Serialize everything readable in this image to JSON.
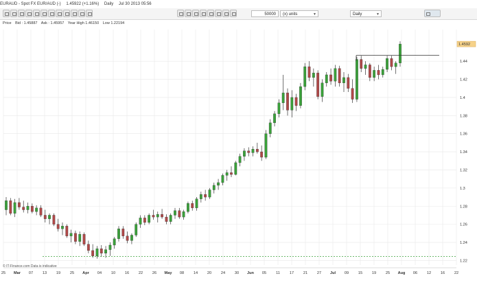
{
  "title_bar": {
    "symbol": "EURAUD - Spot FX EUR/AUD (-)",
    "price": "1.45922 (+1.16%)",
    "interval": "Daily",
    "datetime": "Jul 30 2013 05:56"
  },
  "toolbar": {
    "quantity": "50000",
    "units_label": "(x) units",
    "period": "Daily"
  },
  "infobar": {
    "price_label": "Price",
    "bid": "Bid : 1.45887",
    "ask": "Ask : 1.45957",
    "year_high": "Year High 1.46150",
    "low": "Low 1.22194"
  },
  "footer": "© IT-Finance.com  Data is indicative",
  "colors": {
    "up": "#3aa13a",
    "down": "#b04848",
    "wick": "#333333",
    "grid": "#e8e8e8",
    "support": "#3aa13a",
    "price_tag": "#f6d28a"
  },
  "chart_data": {
    "type": "candlestick",
    "y_ticks": [
      "1.44",
      "1.42",
      "1.4",
      "1.38",
      "1.36",
      "1.34",
      "1.32",
      "1.3",
      "1.28",
      "1.26",
      "1.24",
      "1.22"
    ],
    "x_ticks": [
      "25",
      "Mar",
      "07",
      "13",
      "19",
      "25",
      "Apr",
      "04",
      "10",
      "16",
      "22",
      "26",
      "May",
      "08",
      "14",
      "20",
      "24",
      "30",
      "Jun",
      "05",
      "11",
      "17",
      "21",
      "27",
      "Jul",
      "09",
      "15",
      "19",
      "25",
      "Aug",
      "06",
      "12",
      "16",
      "22"
    ],
    "last_price_tag": "1.4592",
    "ylim": [
      1.215,
      1.475
    ],
    "resistance_level": 1.4465,
    "support_level": 1.2245,
    "grid": true,
    "candles": [
      [
        1.276,
        1.29,
        1.27,
        1.286
      ],
      [
        1.286,
        1.289,
        1.27,
        1.272
      ],
      [
        1.272,
        1.288,
        1.268,
        1.284
      ],
      [
        1.284,
        1.289,
        1.276,
        1.279
      ],
      [
        1.279,
        1.286,
        1.273,
        1.276
      ],
      [
        1.276,
        1.284,
        1.272,
        1.28
      ],
      [
        1.28,
        1.283,
        1.272,
        1.274
      ],
      [
        1.274,
        1.281,
        1.27,
        1.278
      ],
      [
        1.278,
        1.281,
        1.268,
        1.27
      ],
      [
        1.27,
        1.276,
        1.262,
        1.266
      ],
      [
        1.266,
        1.272,
        1.26,
        1.27
      ],
      [
        1.27,
        1.272,
        1.258,
        1.26
      ],
      [
        1.26,
        1.266,
        1.252,
        1.255
      ],
      [
        1.255,
        1.262,
        1.248,
        1.258
      ],
      [
        1.258,
        1.26,
        1.245,
        1.247
      ],
      [
        1.247,
        1.254,
        1.24,
        1.25
      ],
      [
        1.25,
        1.253,
        1.238,
        1.241
      ],
      [
        1.241,
        1.252,
        1.236,
        1.249
      ],
      [
        1.249,
        1.251,
        1.236,
        1.238
      ],
      [
        1.238,
        1.242,
        1.228,
        1.231
      ],
      [
        1.231,
        1.238,
        1.223,
        1.225
      ],
      [
        1.225,
        1.236,
        1.222,
        1.233
      ],
      [
        1.233,
        1.237,
        1.224,
        1.228
      ],
      [
        1.228,
        1.236,
        1.223,
        1.232
      ],
      [
        1.232,
        1.24,
        1.225,
        1.237
      ],
      [
        1.237,
        1.246,
        1.233,
        1.244
      ],
      [
        1.244,
        1.258,
        1.241,
        1.255
      ],
      [
        1.255,
        1.258,
        1.244,
        1.247
      ],
      [
        1.247,
        1.252,
        1.239,
        1.242
      ],
      [
        1.242,
        1.25,
        1.238,
        1.248
      ],
      [
        1.248,
        1.262,
        1.246,
        1.26
      ],
      [
        1.26,
        1.27,
        1.256,
        1.267
      ],
      [
        1.267,
        1.27,
        1.259,
        1.262
      ],
      [
        1.262,
        1.272,
        1.26,
        1.27
      ],
      [
        1.27,
        1.276,
        1.265,
        1.268
      ],
      [
        1.268,
        1.274,
        1.262,
        1.271
      ],
      [
        1.271,
        1.277,
        1.266,
        1.268
      ],
      [
        1.268,
        1.271,
        1.26,
        1.263
      ],
      [
        1.263,
        1.272,
        1.26,
        1.27
      ],
      [
        1.27,
        1.278,
        1.266,
        1.275
      ],
      [
        1.275,
        1.278,
        1.266,
        1.268
      ],
      [
        1.268,
        1.276,
        1.265,
        1.274
      ],
      [
        1.274,
        1.285,
        1.272,
        1.283
      ],
      [
        1.283,
        1.286,
        1.275,
        1.278
      ],
      [
        1.278,
        1.29,
        1.275,
        1.288
      ],
      [
        1.288,
        1.296,
        1.284,
        1.293
      ],
      [
        1.293,
        1.298,
        1.286,
        1.29
      ],
      [
        1.29,
        1.3,
        1.288,
        1.298
      ],
      [
        1.298,
        1.306,
        1.294,
        1.303
      ],
      [
        1.303,
        1.31,
        1.298,
        1.306
      ],
      [
        1.306,
        1.316,
        1.303,
        1.314
      ],
      [
        1.314,
        1.32,
        1.308,
        1.317
      ],
      [
        1.317,
        1.324,
        1.312,
        1.315
      ],
      [
        1.315,
        1.33,
        1.314,
        1.328
      ],
      [
        1.328,
        1.338,
        1.324,
        1.335
      ],
      [
        1.335,
        1.344,
        1.33,
        1.341
      ],
      [
        1.341,
        1.345,
        1.335,
        1.339
      ],
      [
        1.339,
        1.346,
        1.335,
        1.343
      ],
      [
        1.343,
        1.35,
        1.338,
        1.34
      ],
      [
        1.34,
        1.347,
        1.33,
        1.334
      ],
      [
        1.334,
        1.364,
        1.332,
        1.36
      ],
      [
        1.36,
        1.376,
        1.356,
        1.372
      ],
      [
        1.372,
        1.385,
        1.368,
        1.382
      ],
      [
        1.382,
        1.398,
        1.378,
        1.394
      ],
      [
        1.394,
        1.425,
        1.386,
        1.405
      ],
      [
        1.405,
        1.41,
        1.38,
        1.386
      ],
      [
        1.386,
        1.408,
        1.378,
        1.4
      ],
      [
        1.4,
        1.404,
        1.385,
        1.391
      ],
      [
        1.391,
        1.416,
        1.388,
        1.412
      ],
      [
        1.412,
        1.438,
        1.408,
        1.434
      ],
      [
        1.434,
        1.44,
        1.418,
        1.422
      ],
      [
        1.422,
        1.432,
        1.412,
        1.427
      ],
      [
        1.427,
        1.43,
        1.398,
        1.401
      ],
      [
        1.401,
        1.42,
        1.395,
        1.416
      ],
      [
        1.416,
        1.428,
        1.412,
        1.425
      ],
      [
        1.425,
        1.432,
        1.414,
        1.418
      ],
      [
        1.418,
        1.436,
        1.412,
        1.432
      ],
      [
        1.432,
        1.435,
        1.412,
        1.416
      ],
      [
        1.416,
        1.428,
        1.406,
        1.422
      ],
      [
        1.422,
        1.426,
        1.406,
        1.41
      ],
      [
        1.41,
        1.42,
        1.394,
        1.398
      ],
      [
        1.398,
        1.445,
        1.395,
        1.442
      ],
      [
        1.442,
        1.446,
        1.428,
        1.432
      ],
      [
        1.432,
        1.44,
        1.425,
        1.436
      ],
      [
        1.436,
        1.438,
        1.418,
        1.422
      ],
      [
        1.422,
        1.434,
        1.418,
        1.43
      ],
      [
        1.43,
        1.436,
        1.42,
        1.425
      ],
      [
        1.425,
        1.434,
        1.422,
        1.431
      ],
      [
        1.431,
        1.446,
        1.428,
        1.443
      ],
      [
        1.443,
        1.446,
        1.43,
        1.434
      ],
      [
        1.434,
        1.44,
        1.426,
        1.438
      ],
      [
        1.438,
        1.462,
        1.434,
        1.459
      ]
    ]
  }
}
